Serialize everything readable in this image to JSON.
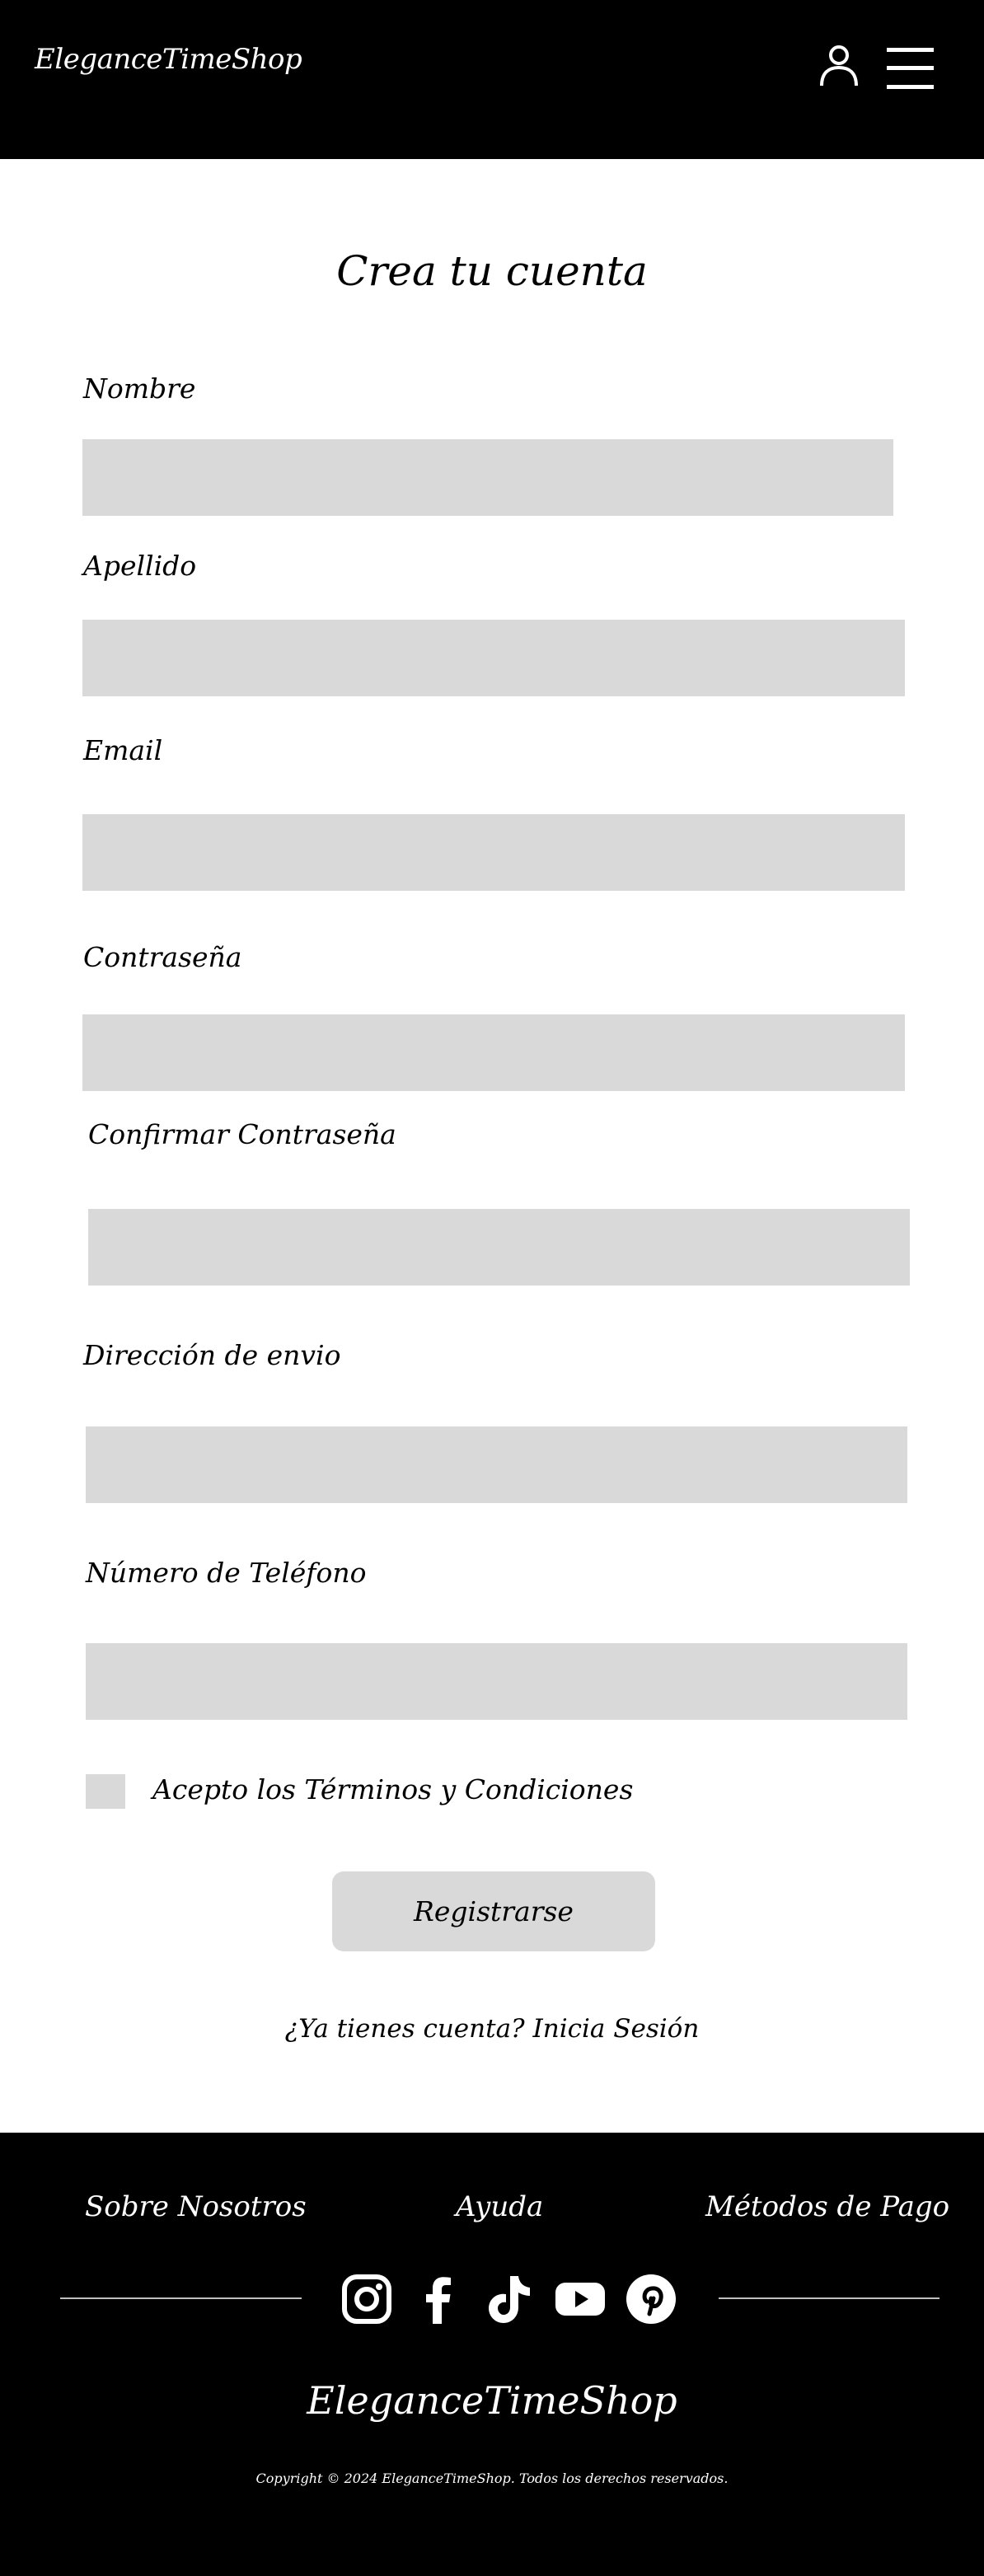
{
  "header": {
    "brand": "EleganceTimeShop",
    "icons": [
      "user-icon",
      "menu-icon"
    ]
  },
  "form": {
    "title": "Crea tu cuenta",
    "fields": {
      "nombre": {
        "label": "Nombre",
        "value": ""
      },
      "apellido": {
        "label": "Apellido",
        "value": ""
      },
      "email": {
        "label": "Email",
        "value": ""
      },
      "contrasena": {
        "label": "Contraseña",
        "value": ""
      },
      "confirmar": {
        "label": "Confirmar Contraseña",
        "value": ""
      },
      "direccion": {
        "label": "Dirección de envio",
        "value": ""
      },
      "telefono": {
        "label": "Número de Teléfono",
        "value": ""
      }
    },
    "terms_label": "Acepto los Términos y Condiciones",
    "terms_checked": false,
    "submit_label": "Registrarse",
    "login_prompt": "¿Ya tienes cuenta? Inicia Sesión"
  },
  "footer": {
    "links": [
      "Sobre Nosotros",
      "Ayuda",
      "Métodos de Pago"
    ],
    "social": [
      "instagram-icon",
      "facebook-icon",
      "tiktok-icon",
      "youtube-icon",
      "pinterest-icon"
    ],
    "brand": "EleganceTimeShop",
    "copyright": "Copyright © 2024 EleganceTimeShop. Todos los derechos reservados."
  },
  "colors": {
    "header_bg": "#000000",
    "footer_bg": "#000000",
    "field_bg": "#d9d9d9",
    "text": "#000000",
    "text_inverse": "#ffffff"
  }
}
